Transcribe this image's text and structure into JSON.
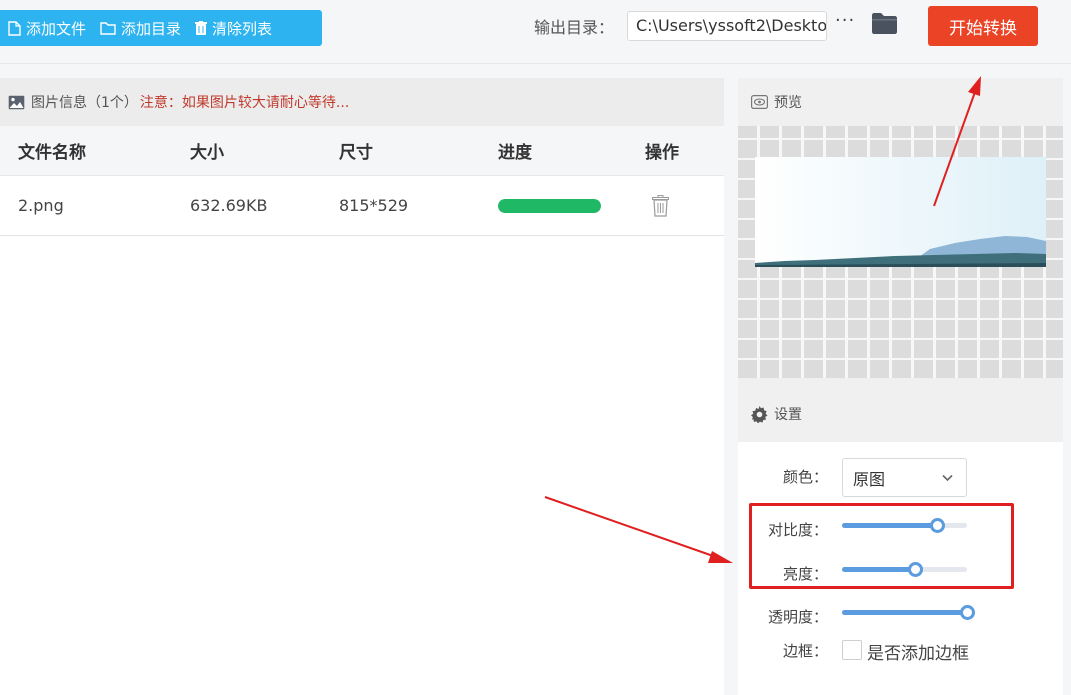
{
  "toolbar": {
    "add_file": "添加文件",
    "add_dir": "添加目录",
    "clear_list": "清除列表"
  },
  "output": {
    "label": "输出目录：",
    "path": "C:\\Users\\yssoft2\\Deskto",
    "more": "···",
    "start": "开始转换"
  },
  "info": {
    "title": "图片信息（1个）",
    "note": "注意：如果图片较大请耐心等待..."
  },
  "table": {
    "headers": [
      "文件名称",
      "大小",
      "尺寸",
      "进度",
      "操作"
    ],
    "rows": [
      {
        "name": "2.png",
        "size": "632.69KB",
        "dims": "815*529",
        "progress": 100
      }
    ]
  },
  "preview": {
    "title": "预览"
  },
  "settings": {
    "title": "设置",
    "color_label": "颜色：",
    "color_value": "原图",
    "contrast_label": "对比度：",
    "brightness_label": "亮度：",
    "opacity_label": "透明度：",
    "border_label": "边框：",
    "border_checkbox": "是否添加边框",
    "contrast_level": 0.76,
    "brightness_level": 0.58,
    "opacity_level": 1.0,
    "border_checked": false
  },
  "colors": {
    "toolbar_bg": "#2cb3f0",
    "start_button": "#ea4326",
    "progress": "#1fb965",
    "slider": "#5b9be0",
    "annotation": "#e02020"
  }
}
